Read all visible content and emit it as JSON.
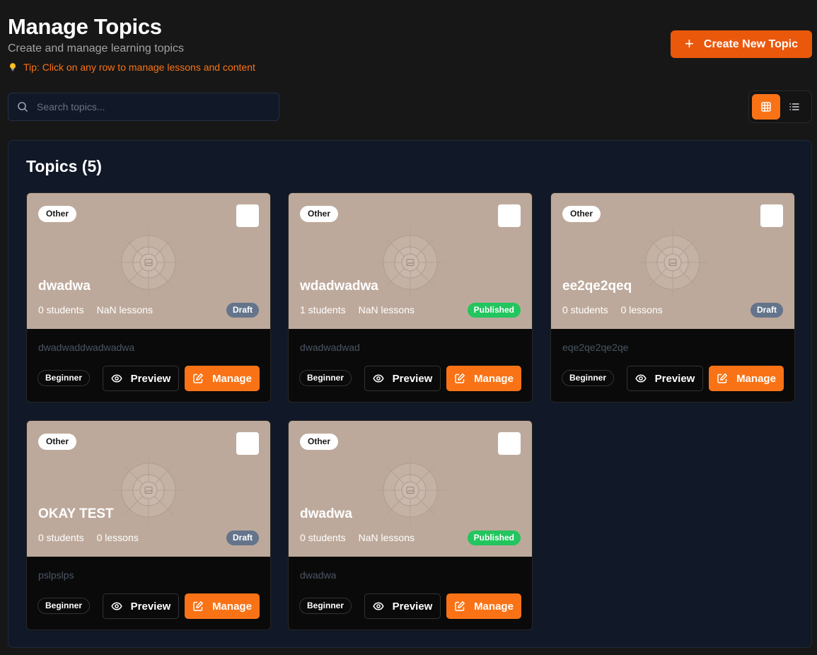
{
  "header": {
    "title": "Manage Topics",
    "subtitle": "Create and manage learning topics",
    "tip": "Tip: Click on any row to manage lessons and content",
    "create_button": "Create New Topic"
  },
  "search": {
    "placeholder": "Search topics..."
  },
  "view_toggle": {
    "active": "grid"
  },
  "panel": {
    "title": "Topics (5)"
  },
  "colors": {
    "accent": "#f97316",
    "draft": "#64748b",
    "published": "#22c55e",
    "hero": "#bda99b"
  },
  "topics": [
    {
      "category": "Other",
      "title": "dwadwa",
      "students": "0 students",
      "lessons": "NaN lessons",
      "status": "Draft",
      "description": "dwadwaddwadwadwa",
      "level": "Beginner",
      "preview": "Preview",
      "manage": "Manage"
    },
    {
      "category": "Other",
      "title": "wdadwadwa",
      "students": "1 students",
      "lessons": "NaN lessons",
      "status": "Published",
      "description": "dwadwadwad",
      "level": "Beginner",
      "preview": "Preview",
      "manage": "Manage"
    },
    {
      "category": "Other",
      "title": "ee2qe2qeq",
      "students": "0 students",
      "lessons": "0 lessons",
      "status": "Draft",
      "description": "eqe2qe2qe2qe",
      "level": "Beginner",
      "preview": "Preview",
      "manage": "Manage"
    },
    {
      "category": "Other",
      "title": "OKAY TEST",
      "students": "0 students",
      "lessons": "0 lessons",
      "status": "Draft",
      "description": "pslpslps",
      "level": "Beginner",
      "preview": "Preview",
      "manage": "Manage"
    },
    {
      "category": "Other",
      "title": "dwadwa",
      "students": "0 students",
      "lessons": "NaN lessons",
      "status": "Published",
      "description": "dwadwa",
      "level": "Beginner",
      "preview": "Preview",
      "manage": "Manage"
    }
  ]
}
